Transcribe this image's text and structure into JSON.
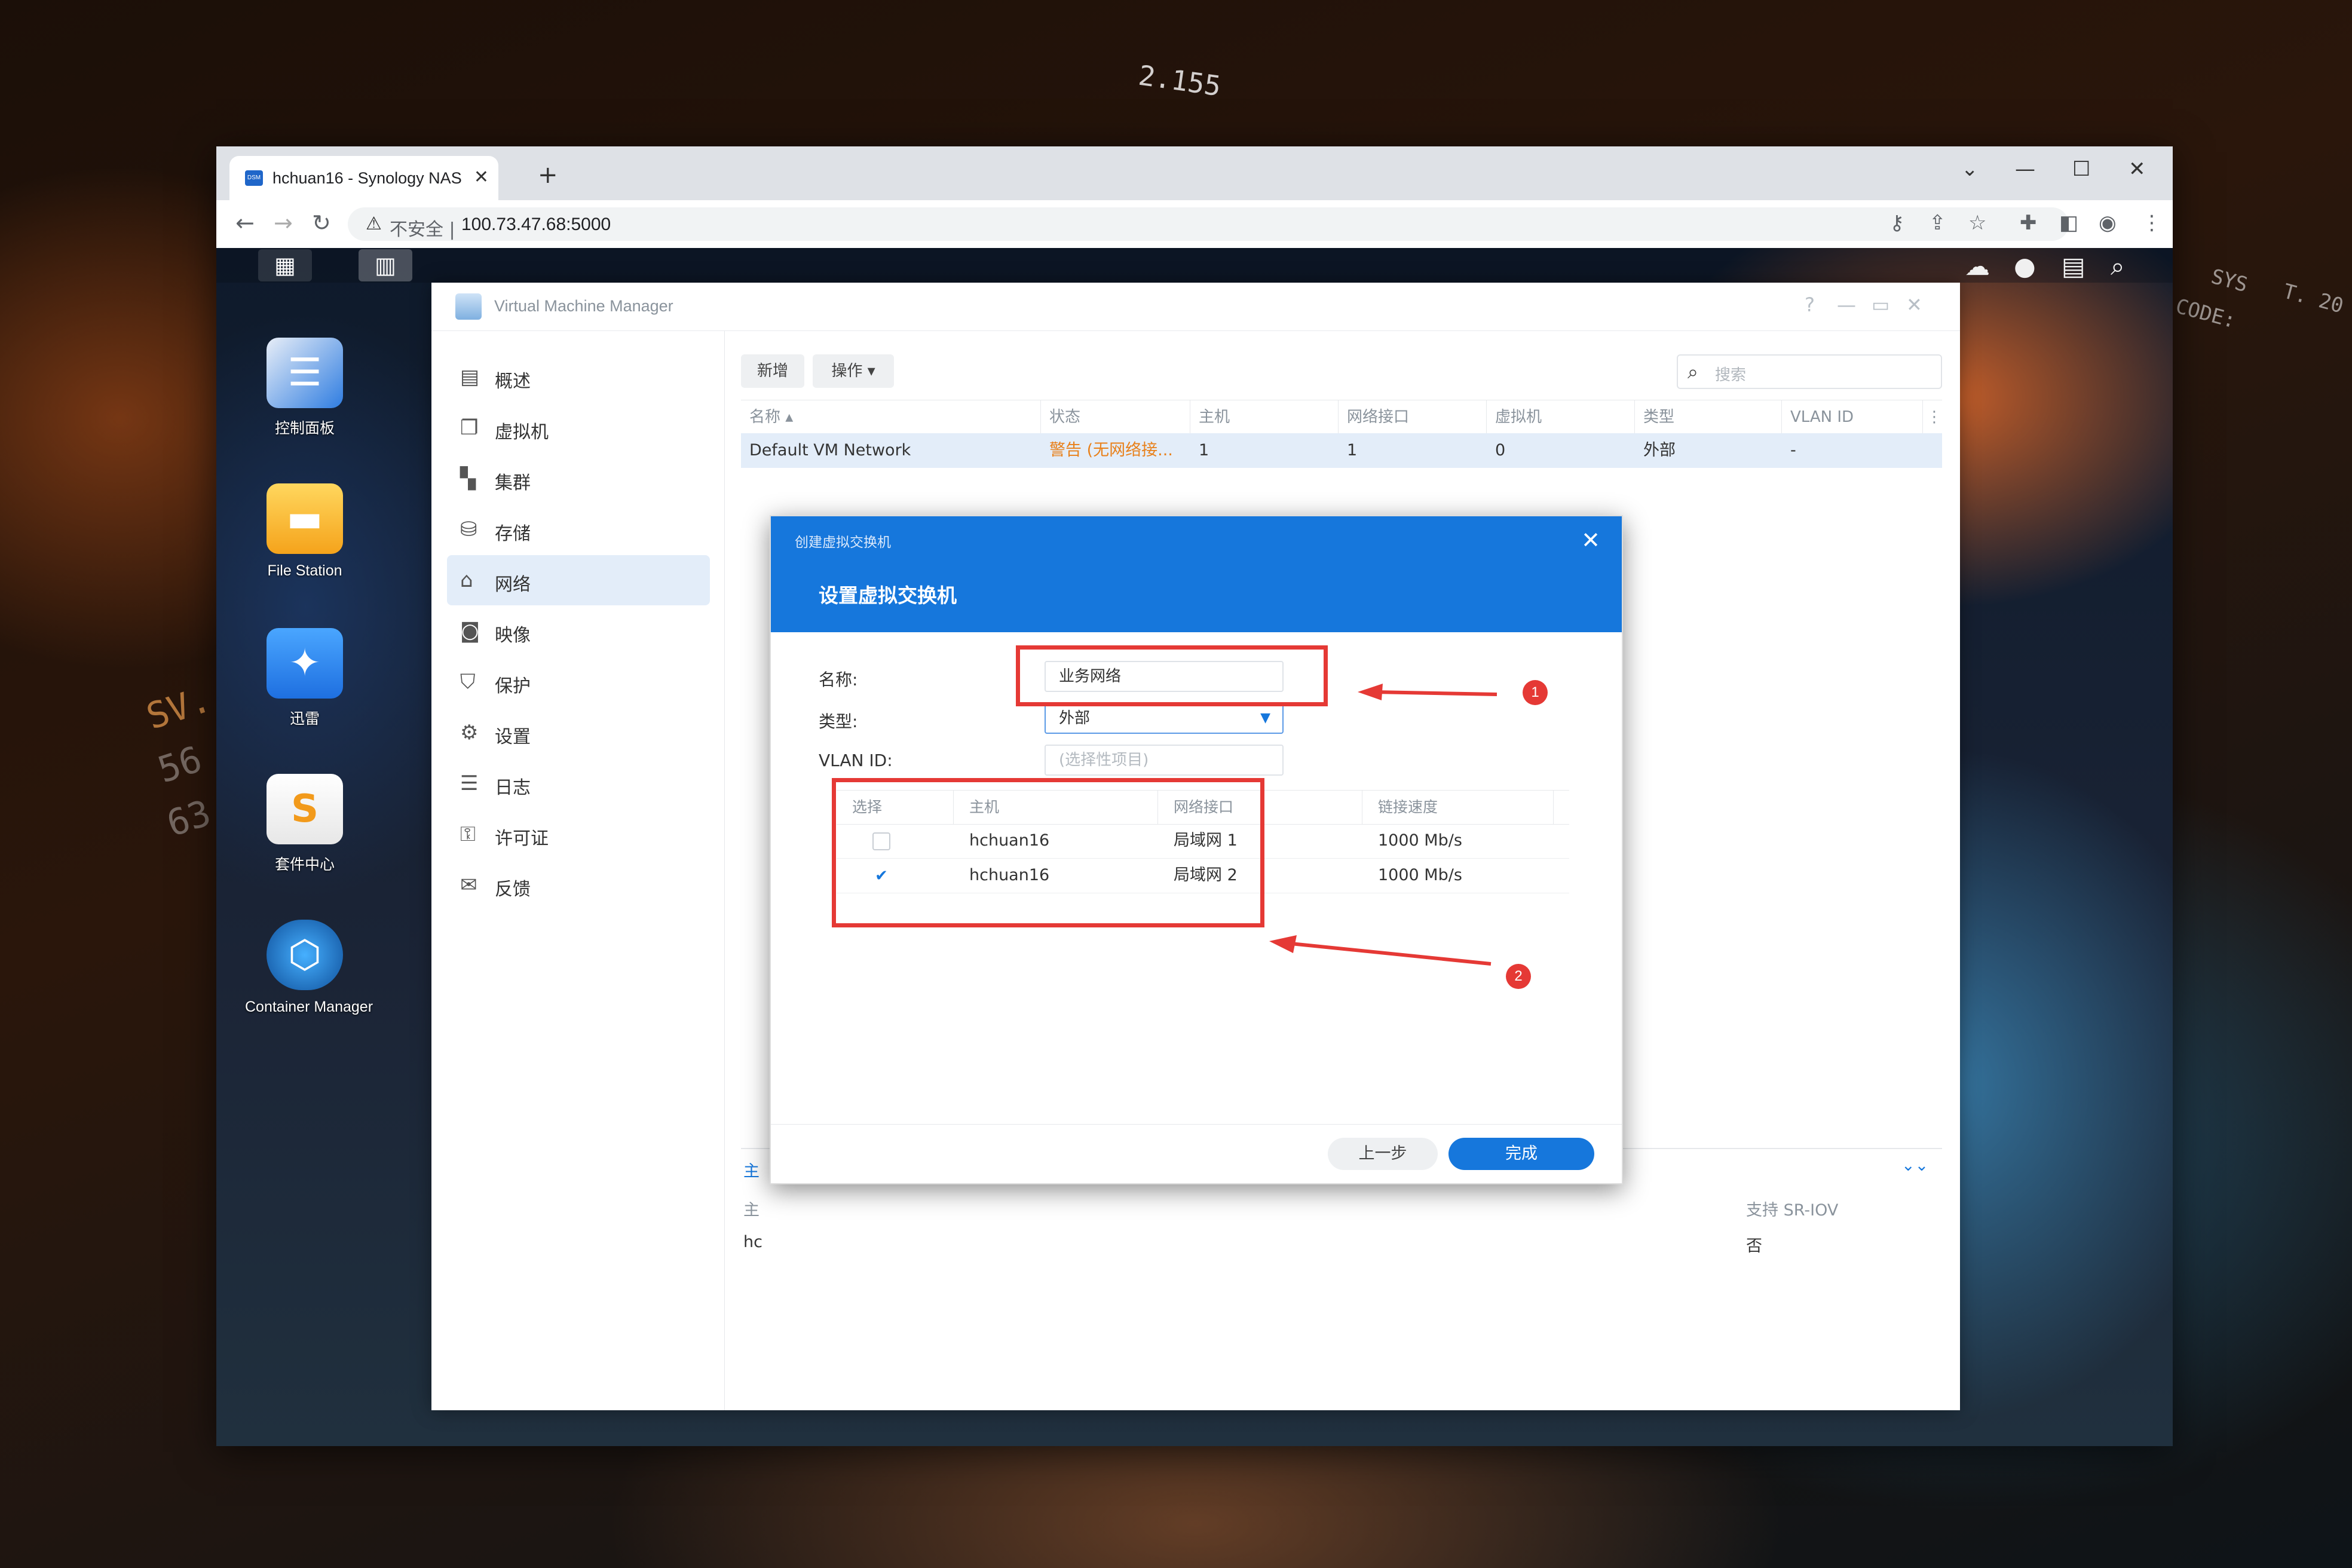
{
  "wallpaper": {
    "hud_1": "2.155",
    "hud_2": "SYS",
    "hud_3": "T. 20",
    "hud_4": "CODE:",
    "hud_5": "SV.",
    "hud_6": "56",
    "hud_7": "63"
  },
  "browser": {
    "tab_title": "hchuan16 - Synology NAS",
    "tab_favicon": "DSM",
    "new_tab": "+",
    "insecure_label": "不安全",
    "separator": "|",
    "url": "100.73.47.68:5000",
    "window_controls": {
      "chevron": "⌄",
      "minimize": "—",
      "maximize": "☐",
      "close": "✕"
    },
    "nav": {
      "back": "←",
      "forward": "→",
      "reload": "↻"
    },
    "toolbar_icons": [
      "key-icon",
      "share-icon",
      "star-icon",
      "extension-icon",
      "sidepanel-icon",
      "profile-icon",
      "menu-icon"
    ]
  },
  "dsm": {
    "desktop_icons": [
      {
        "label": "控制面板",
        "icon": "control-panel-icon",
        "color": "#2f7de1"
      },
      {
        "label": "File Station",
        "icon": "folder-icon",
        "color": "#f5b21b"
      },
      {
        "label": "迅雷",
        "icon": "thunder-bird-icon",
        "color": "#2c8fff"
      },
      {
        "label": "套件中心",
        "icon": "package-center-icon",
        "color": "#f2f2f2"
      },
      {
        "label": "Container Manager",
        "icon": "container-icon",
        "color": "#1a7fd6"
      }
    ]
  },
  "vmm": {
    "title": "Virtual Machine Manager",
    "controls": {
      "help": "?",
      "min": "—",
      "max": "▭",
      "close": "✕"
    },
    "sidebar": [
      {
        "label": "概述",
        "icon": "overview-icon"
      },
      {
        "label": "虚拟机",
        "icon": "vm-icon"
      },
      {
        "label": "集群",
        "icon": "cluster-icon"
      },
      {
        "label": "存储",
        "icon": "storage-icon"
      },
      {
        "label": "网络",
        "icon": "network-icon",
        "active": true
      },
      {
        "label": "映像",
        "icon": "image-icon"
      },
      {
        "label": "保护",
        "icon": "protection-icon"
      },
      {
        "label": "设置",
        "icon": "settings-icon"
      },
      {
        "label": "日志",
        "icon": "log-icon"
      },
      {
        "label": "许可证",
        "icon": "license-icon"
      },
      {
        "label": "反馈",
        "icon": "feedback-icon"
      }
    ],
    "toolbar": {
      "add": "新增",
      "action": "操作 ▾",
      "search_placeholder": "搜索"
    },
    "table": {
      "headers": [
        "名称 ▴",
        "状态",
        "主机",
        "网络接口",
        "虚拟机",
        "类型",
        "VLAN ID"
      ],
      "rows": [
        [
          "Default VM Network",
          "警告 (无网络接...",
          "1",
          "1",
          "0",
          "外部",
          "-"
        ]
      ]
    },
    "lower": {
      "tab_partial": "主",
      "col_partial": "主",
      "cell_partial": "hc",
      "col_sriov": "支持 SR-IOV",
      "val_sriov": "否",
      "expand_icon": "⌄⌄"
    }
  },
  "modal": {
    "small_title": "创建虚拟交换机",
    "close": "✕",
    "title": "设置虚拟交换机",
    "name_label": "名称:",
    "name_value": "业务网络",
    "type_label": "类型:",
    "type_value": "外部",
    "vlan_label": "VLAN ID:",
    "vlan_placeholder": "(选择性项目)",
    "table": {
      "headers": [
        "选择",
        "主机",
        "网络接口",
        "链接速度"
      ],
      "rows": [
        {
          "checked": false,
          "host": "hchuan16",
          "iface": "局域网 1",
          "speed": "1000 Mb/s"
        },
        {
          "checked": true,
          "host": "hchuan16",
          "iface": "局域网 2",
          "speed": "1000 Mb/s"
        }
      ]
    },
    "back_button": "上一步",
    "finish_button": "完成"
  },
  "annotations": {
    "badge_1": "1",
    "badge_2": "2",
    "color": "#e53935"
  },
  "colors": {
    "accent": "#1677dc",
    "warning": "#e8801a",
    "selected_row": "#e3edf9"
  }
}
